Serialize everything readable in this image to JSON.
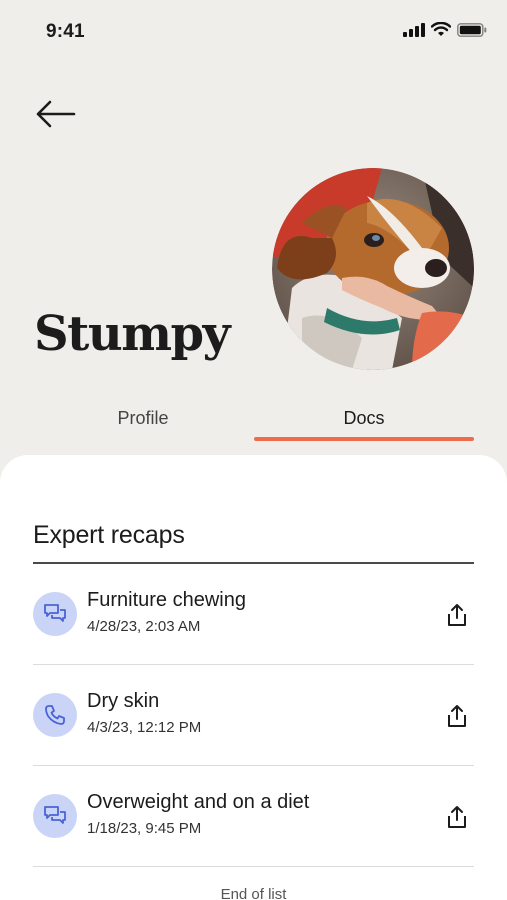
{
  "status_bar": {
    "time": "9:41"
  },
  "pet": {
    "name": "Stumpy"
  },
  "tabs": [
    {
      "label": "Profile",
      "active": false
    },
    {
      "label": "Docs",
      "active": true
    }
  ],
  "colors": {
    "accent": "#ef6c4a",
    "icon_bg": "#c9d4f7",
    "icon_fg": "#4a63d6"
  },
  "section": {
    "title": "Expert recaps",
    "items": [
      {
        "title": "Furniture chewing",
        "date": "4/28/23, 2:03 AM",
        "icon": "chat-bubbles-icon"
      },
      {
        "title": "Dry skin",
        "date": "4/3/23, 12:12 PM",
        "icon": "phone-icon"
      },
      {
        "title": "Overweight and on a diet",
        "date": "1/18/23, 9:45 PM",
        "icon": "chat-bubbles-icon"
      }
    ],
    "end_text": "End of list"
  }
}
